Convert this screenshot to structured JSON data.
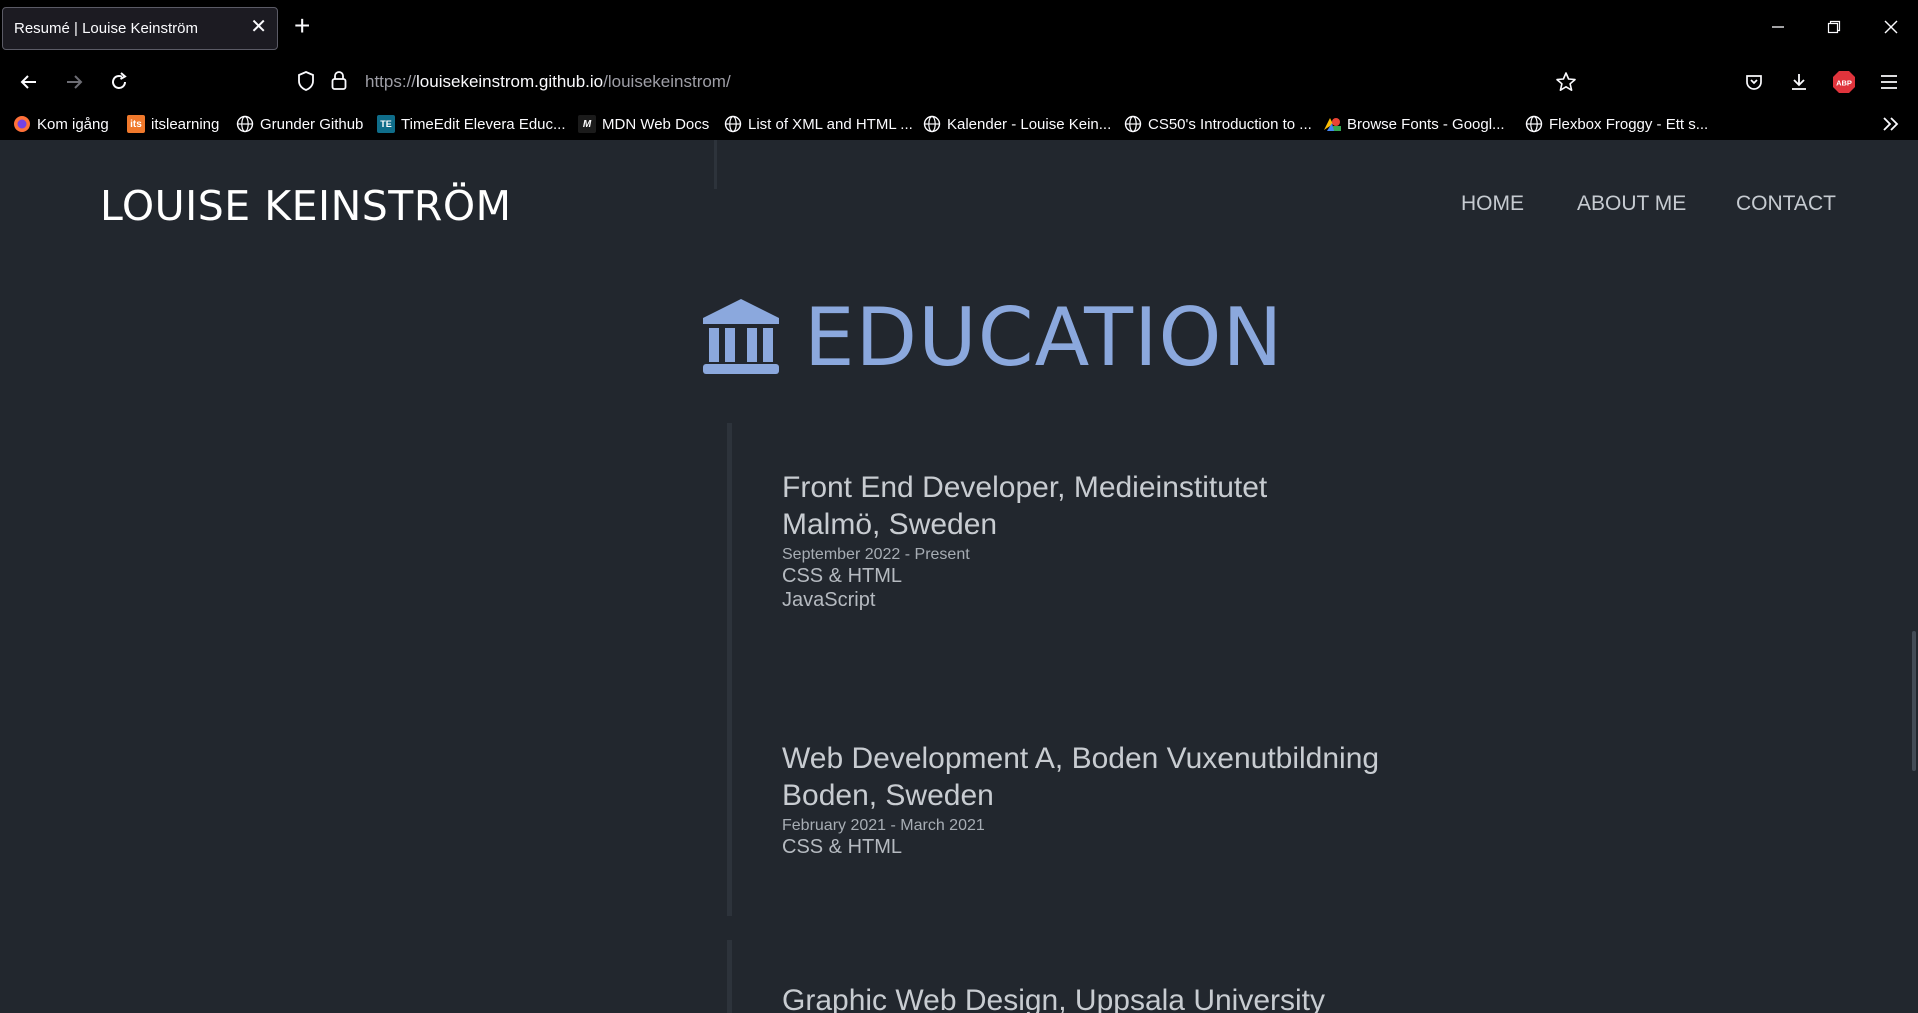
{
  "browser": {
    "tab_title": "Resumé | Louise Keinström",
    "tab_close": "✕",
    "new_tab": "+",
    "url_prefix": "https://",
    "url_host": "louisekeinstrom.github.io",
    "url_path": "/louisekeinstrom/",
    "bookmarks": [
      {
        "label": "Kom igång",
        "icon": "firefox-icon"
      },
      {
        "label": "itslearning",
        "icon": "itslearning-icon",
        "badge": "its"
      },
      {
        "label": "Grunder Github",
        "icon": "globe-icon"
      },
      {
        "label": "TimeEdit Elevera Educ...",
        "icon": "timeedit-icon",
        "badge": "TE"
      },
      {
        "label": "MDN Web Docs",
        "icon": "mdn-icon",
        "badge": "M"
      },
      {
        "label": "List of XML and HTML ...",
        "icon": "globe-icon"
      },
      {
        "label": "Kalender - Louise Kein...",
        "icon": "globe-icon"
      },
      {
        "label": "CS50's Introduction to ...",
        "icon": "globe-icon"
      },
      {
        "label": "Browse Fonts - Googl...",
        "icon": "google-fonts-icon"
      },
      {
        "label": "Flexbox Froggy - Ett s...",
        "icon": "globe-icon"
      }
    ],
    "abp_label": "ABP"
  },
  "site": {
    "title": "LOUISE KEINSTRÖM",
    "nav": [
      "HOME",
      "ABOUT ME",
      "CONTACT"
    ]
  },
  "education": {
    "heading": "EDUCATION",
    "icon": "university-icon",
    "accent_color": "#8ba8dd",
    "entries": [
      {
        "title": "Front End Developer, Medieinstitutet",
        "location": "Malmö, Sweden",
        "date": "September 2022 - Present",
        "skills": [
          "CSS & HTML",
          "JavaScript"
        ]
      },
      {
        "title": "Web Development A, Boden Vuxenutbildning",
        "location": "Boden, Sweden",
        "date": "February 2021 - March 2021",
        "skills": [
          "CSS & HTML"
        ]
      },
      {
        "title": "Graphic Web Design, Uppsala University",
        "location": "",
        "date": "",
        "skills": []
      }
    ]
  }
}
